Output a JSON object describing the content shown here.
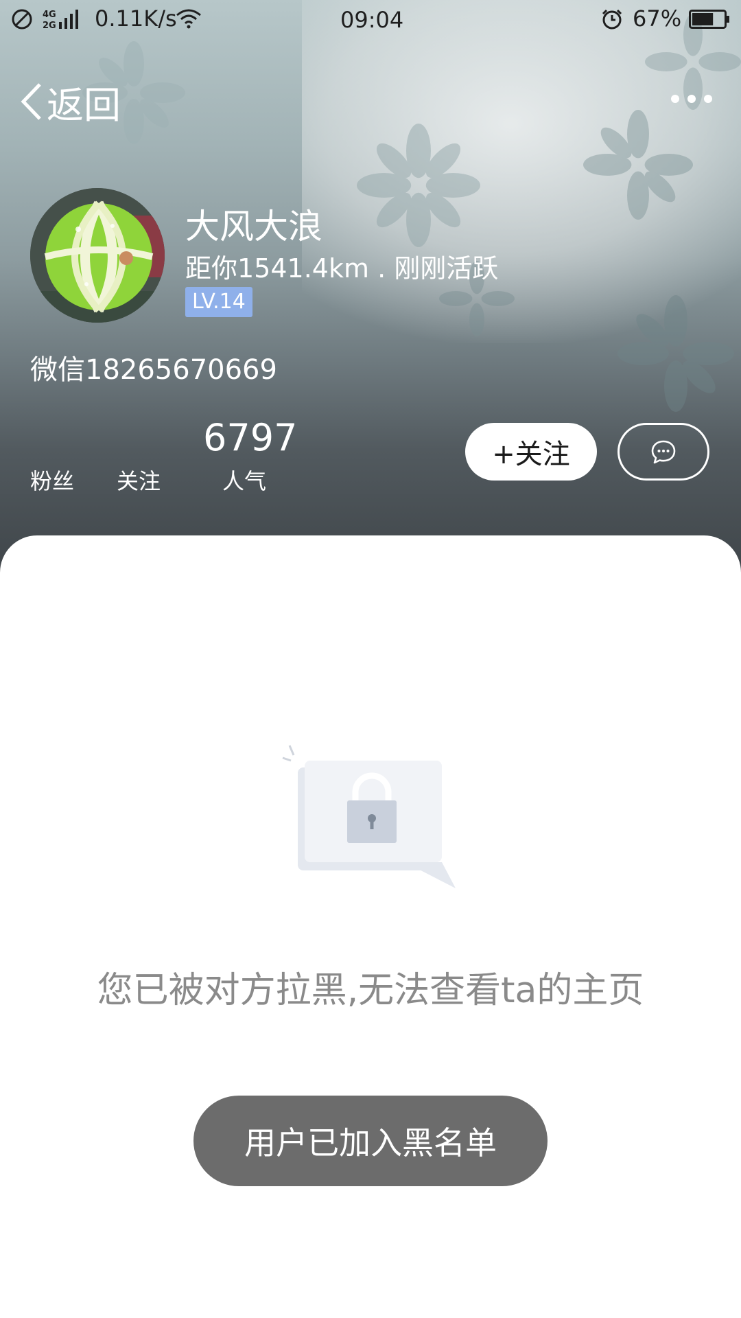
{
  "status_bar": {
    "network": "4G 2G",
    "speed": "0.11K/s",
    "time": "09:04",
    "battery": "67%",
    "icons": [
      "do-not-disturb-icon",
      "signal-icon",
      "wifi-icon",
      "alarm-icon",
      "battery-icon"
    ]
  },
  "nav": {
    "back_label": "返回",
    "icons": [
      "chevron-left-icon",
      "more-icon"
    ]
  },
  "profile": {
    "name": "大风大浪",
    "distance": "距你1541.4km . 刚刚活跃",
    "level": "LV.14",
    "wechat": "微信18265670669",
    "avatar": "melon-photo"
  },
  "stats": {
    "fans_label": "粉丝",
    "following_label": "关注",
    "popularity_value": "6797",
    "popularity_label": "人气"
  },
  "actions": {
    "follow_label": "+关注",
    "message_icon": "chat-bubble-icon"
  },
  "blocked": {
    "illustration": "lock-icon",
    "message": "您已被对方拉黑,无法查看ta的主页",
    "button_label": "用户已加入黑名单"
  },
  "colors": {
    "level_badge": "#8fb0ea",
    "blacklist_button": "#6c6c6c",
    "message_text": "#8a8a8a"
  }
}
